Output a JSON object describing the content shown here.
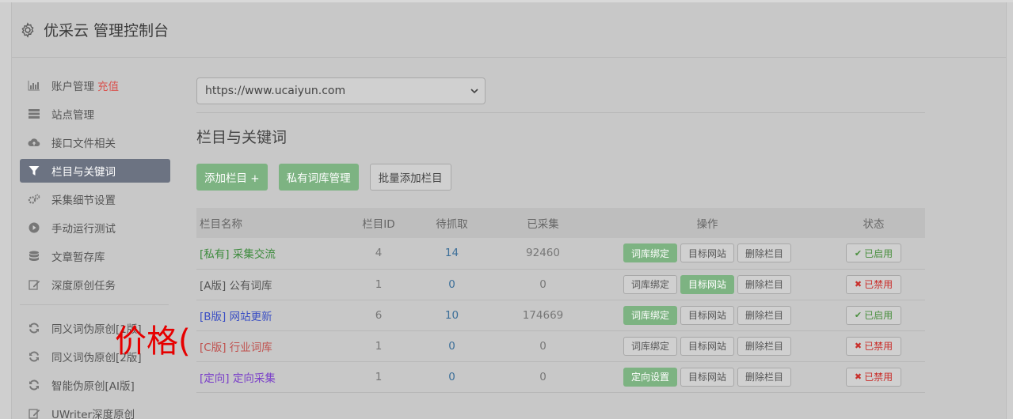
{
  "header": {
    "title": "优采云 管理控制台",
    "icon": "gear-icon"
  },
  "sidebar": {
    "items": [
      {
        "label": "账户管理",
        "extra": "充值",
        "icon": "bar-chart-icon"
      },
      {
        "label": "站点管理",
        "icon": "server-icon"
      },
      {
        "label": "接口文件相关",
        "icon": "cloud-upload-icon"
      },
      {
        "label": "栏目与关键词",
        "icon": "filter-icon",
        "active": true
      },
      {
        "label": "采集细节设置",
        "icon": "cogs-icon"
      },
      {
        "label": "手动运行测试",
        "icon": "play-circle-icon"
      },
      {
        "label": "文章暂存库",
        "icon": "database-icon"
      },
      {
        "label": "深度原创任务",
        "icon": "edit-icon"
      }
    ],
    "items2": [
      {
        "label": "同义词伪原创[1版]",
        "icon": "refresh-icon"
      },
      {
        "label": "同义词伪原创[2版]",
        "icon": "refresh-icon"
      },
      {
        "label": "智能伪原创[AI版]",
        "icon": "refresh-icon"
      },
      {
        "label": "UWriter深度原创",
        "icon": "edit-icon"
      }
    ]
  },
  "main": {
    "site_select": "https://www.ucaiyun.com",
    "section_title": "栏目与关键词",
    "buttons": {
      "add": "添加栏目 +",
      "private": "私有词库管理",
      "batch": "批量添加栏目"
    }
  },
  "table": {
    "headers": [
      "栏目名称",
      "栏目ID",
      "待抓取",
      "已采集",
      "操作",
      "状态"
    ],
    "rows": [
      {
        "name": "[私有] 采集交流",
        "id": "4",
        "pending": "14",
        "collected": "92460",
        "op1": "词库绑定",
        "op2": "目标网站",
        "op3": "删除栏目",
        "status": "已启用"
      },
      {
        "name": "[A版] 公有词库",
        "id": "1",
        "pending": "0",
        "collected": "0",
        "op1": "词库绑定",
        "op2": "目标网站",
        "op3": "删除栏目",
        "status": "已禁用"
      },
      {
        "name": "[B版] 网站更新",
        "id": "6",
        "pending": "10",
        "collected": "174669",
        "op1": "词库绑定",
        "op2": "目标网站",
        "op3": "删除栏目",
        "status": "已启用"
      },
      {
        "name": "[C版] 行业词库",
        "id": "1",
        "pending": "0",
        "collected": "0",
        "op1": "词库绑定",
        "op2": "目标网站",
        "op3": "删除栏目",
        "status": "已禁用"
      },
      {
        "name": "[定向] 定向采集",
        "id": "1",
        "pending": "0",
        "collected": "0",
        "op1": "定向设置",
        "op2": "目标网站",
        "op3": "删除栏目",
        "status": "已禁用"
      }
    ],
    "colors": {
      "private": "#3d8b3d",
      "a": "#555555",
      "b": "#3b4fc4",
      "c": "#c0504d",
      "directed": "#7a3fc9"
    }
  },
  "overlay_text": "价格("
}
